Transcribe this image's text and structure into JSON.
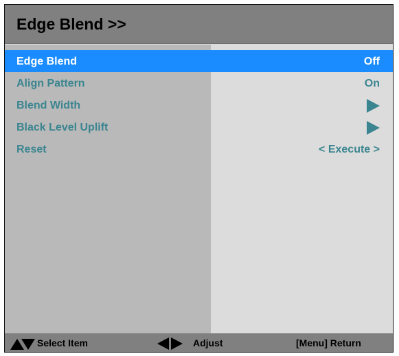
{
  "window": {
    "title": "Edge Blend >>"
  },
  "menu": {
    "items": [
      {
        "label": "Edge Blend",
        "value": "Off",
        "selected": true
      },
      {
        "label": "Align Pattern",
        "value": "On",
        "selected": false
      },
      {
        "label": "Blend Width",
        "value_icon": "triangle-right-icon",
        "selected": false
      },
      {
        "label": "Black Level Uplift",
        "value_icon": "triangle-right-icon",
        "selected": false
      },
      {
        "label": "Reset",
        "value": "< Execute >",
        "selected": false
      }
    ]
  },
  "footer": {
    "select_hint": "Select Item",
    "select_icons": [
      "triangle-up-icon",
      "triangle-down-icon"
    ],
    "adjust_hint": "Adjust",
    "adjust_icons": [
      "triangle-left-icon",
      "triangle-right-icon"
    ],
    "return_hint": "[Menu] Return"
  },
  "colors": {
    "title_bar": "#808080",
    "selected_row": "#1a8cff",
    "item_text": "#3b8590",
    "left_pane": "#b9b9b9",
    "right_pane": "#dcdcdc"
  }
}
